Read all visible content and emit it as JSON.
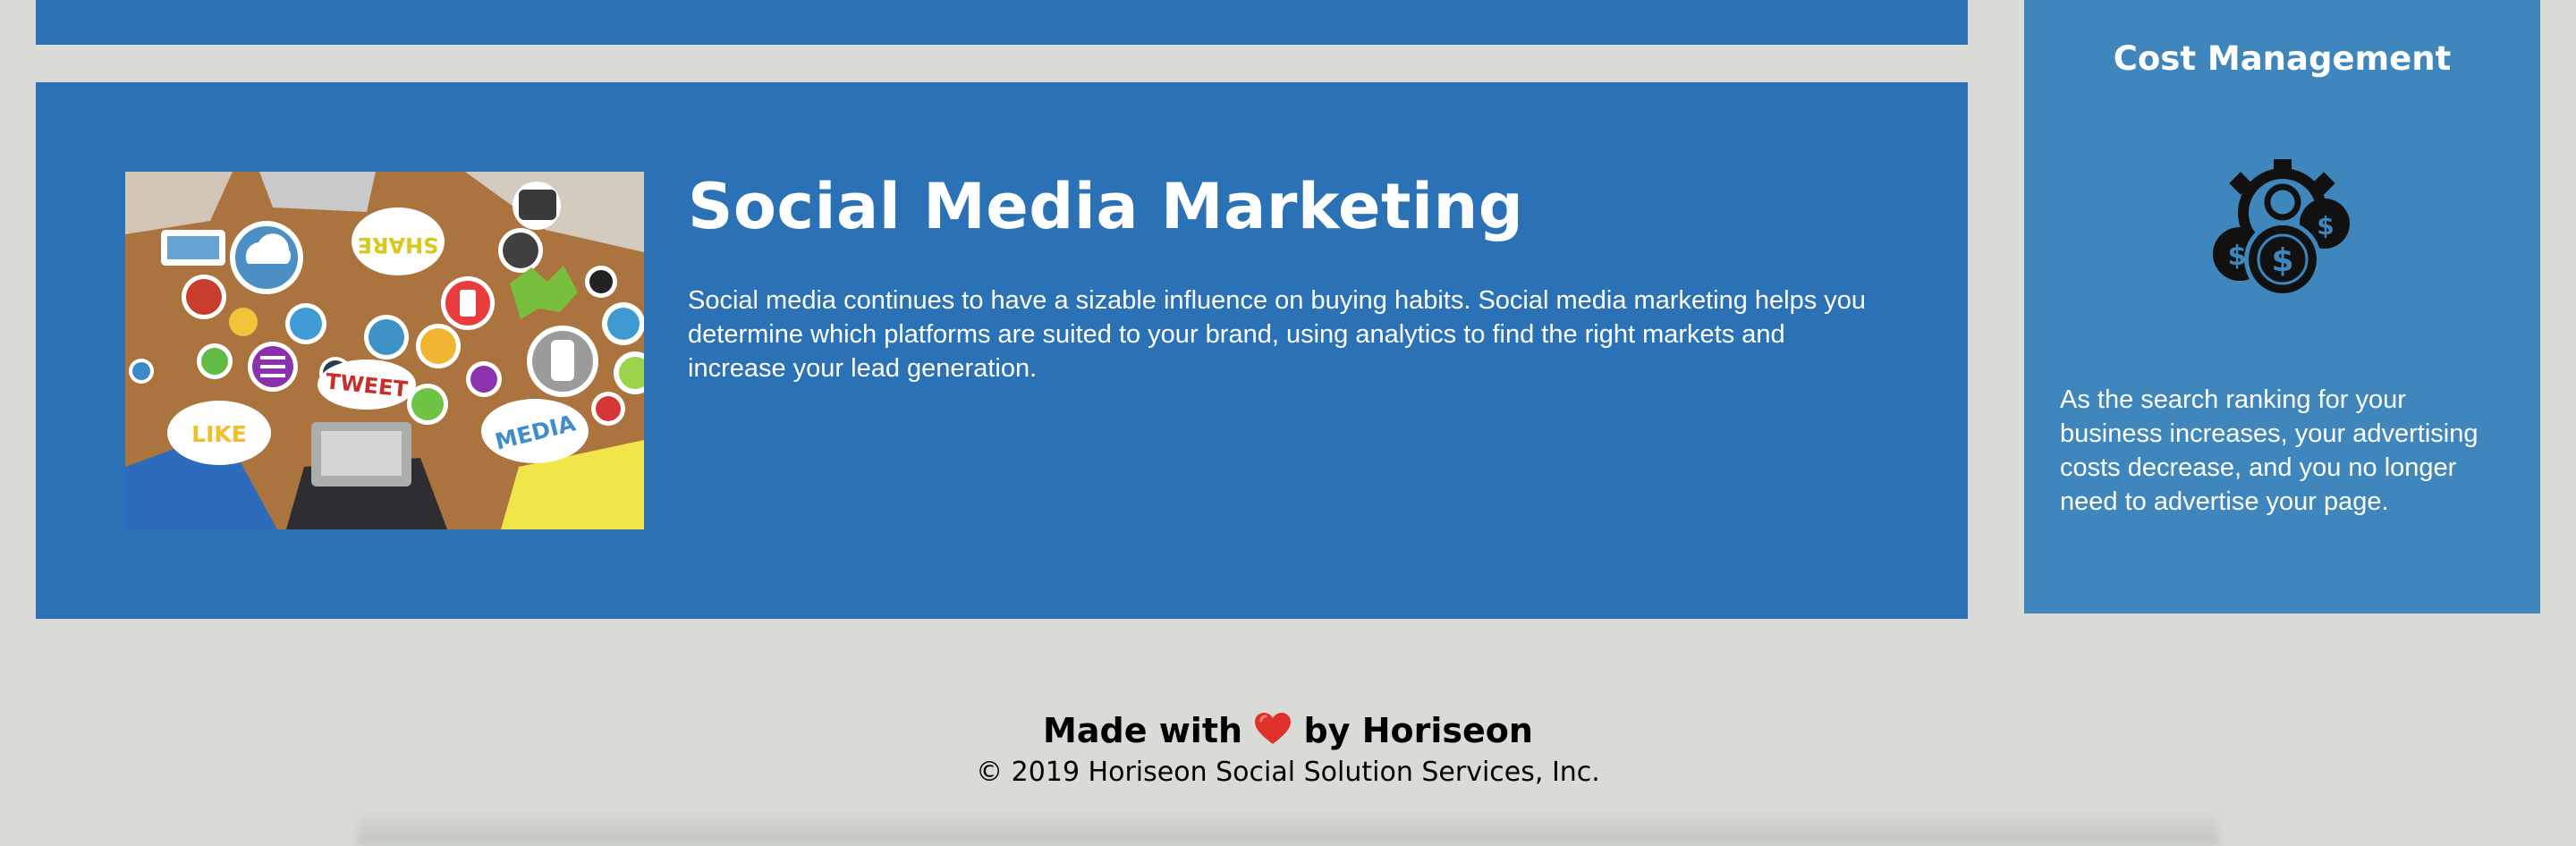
{
  "marketing": {
    "title": "Social Media Marketing",
    "text": "Social media continues to have a sizable influence on buying habits. Social media marketing helps you determine which platforms are suited to your brand, using analytics to find the right markets and increase your lead generation.",
    "image_labels": {
      "share": "SHARE",
      "tweet": "TWEET",
      "like": "LIKE",
      "media": "MEDIA"
    }
  },
  "benefit": {
    "title": "Cost Management",
    "icon": "cost-management-icon",
    "text": "As the search ranking for your business increases, your advertising costs decrease, and you no longer need to advertise your page."
  },
  "footer": {
    "made_prefix": "Made with",
    "made_suffix": "by Horiseon",
    "copyright": "© 2019 Horiseon Social Solution Services, Inc."
  },
  "colors": {
    "page_background": "#d9dcd6",
    "content_card": "#2a72b5",
    "benefit_card": "#3f86bd",
    "heart": "#e0302a"
  }
}
